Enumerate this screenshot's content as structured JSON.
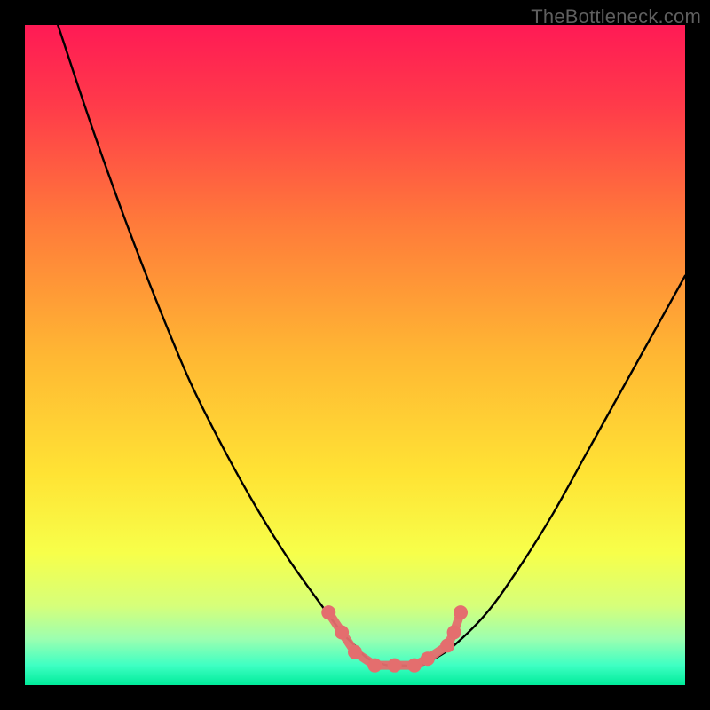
{
  "watermark": {
    "text": "TheBottleneck.com"
  },
  "chart_data": {
    "type": "line",
    "title": "",
    "xlabel": "",
    "ylabel": "",
    "xlim": [
      0,
      100
    ],
    "ylim": [
      0,
      100
    ],
    "grid": false,
    "legend": false,
    "series": [
      {
        "name": "bottleneck-curve",
        "x": [
          5,
          10,
          15,
          20,
          25,
          30,
          35,
          40,
          45,
          48,
          50,
          52,
          55,
          57,
          60,
          62,
          65,
          70,
          75,
          80,
          85,
          90,
          95,
          100
        ],
        "y": [
          100,
          85,
          71,
          58,
          46,
          36,
          27,
          19,
          12,
          8,
          6,
          4,
          3,
          3,
          3,
          4,
          6,
          11,
          18,
          26,
          35,
          44,
          53,
          62
        ]
      }
    ],
    "markers": {
      "name": "highlighted-points",
      "color": "#e46e6e",
      "points": [
        {
          "x": 46,
          "y": 11
        },
        {
          "x": 48,
          "y": 8
        },
        {
          "x": 50,
          "y": 5
        },
        {
          "x": 53,
          "y": 3
        },
        {
          "x": 56,
          "y": 3
        },
        {
          "x": 59,
          "y": 3
        },
        {
          "x": 61,
          "y": 4
        },
        {
          "x": 64,
          "y": 6
        },
        {
          "x": 65,
          "y": 8
        },
        {
          "x": 66,
          "y": 11
        }
      ]
    },
    "background_gradient": {
      "stops": [
        {
          "offset": 0.0,
          "color": "#ff1a55"
        },
        {
          "offset": 0.12,
          "color": "#ff3a4a"
        },
        {
          "offset": 0.3,
          "color": "#ff7a3a"
        },
        {
          "offset": 0.5,
          "color": "#ffb733"
        },
        {
          "offset": 0.68,
          "color": "#ffe334"
        },
        {
          "offset": 0.8,
          "color": "#f7ff4a"
        },
        {
          "offset": 0.88,
          "color": "#d6ff7a"
        },
        {
          "offset": 0.93,
          "color": "#9cffb0"
        },
        {
          "offset": 0.97,
          "color": "#3effc3"
        },
        {
          "offset": 1.0,
          "color": "#00ec9a"
        }
      ]
    }
  }
}
